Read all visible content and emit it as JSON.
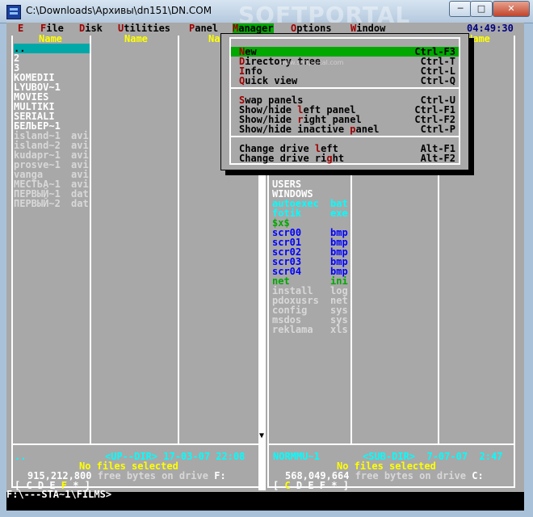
{
  "window": {
    "title": "C:\\Downloads\\Архивы\\dn151\\DN.COM",
    "minimize": "─",
    "maximize": "□",
    "close": "✕",
    "watermark": "SOFTPORTAL",
    "watermark_url": "www.softportal.com"
  },
  "menu": {
    "items": [
      {
        "hk": "E",
        "rest": ""
      },
      {
        "hk": "F",
        "rest": "ile"
      },
      {
        "hk": "D",
        "rest": "isk"
      },
      {
        "hk": "U",
        "rest": "tilities"
      },
      {
        "hk": "P",
        "rest": "anel"
      },
      {
        "hk": "M",
        "rest": "anager"
      },
      {
        "hk": "O",
        "rest": "ptions"
      },
      {
        "hk": "W",
        "rest": "indow"
      }
    ],
    "clock": "04:49:30"
  },
  "left_panel": {
    "col_headers": [
      "Name",
      "Name",
      "Na"
    ],
    "files": [
      {
        "name": "..",
        "ext": "",
        "type": "sel"
      },
      {
        "name": "2",
        "ext": "",
        "type": "dir"
      },
      {
        "name": "3",
        "ext": "",
        "type": "dir"
      },
      {
        "name": "KOMEDII",
        "ext": "",
        "type": "dir"
      },
      {
        "name": "LYUBOV~1",
        "ext": "",
        "type": "dir"
      },
      {
        "name": "MOVIES",
        "ext": "",
        "type": "dir"
      },
      {
        "name": "MULTIKI",
        "ext": "",
        "type": "dir"
      },
      {
        "name": "SERIALI",
        "ext": "",
        "type": "dir"
      },
      {
        "name": "БЕЛЬЕР~1",
        "ext": "",
        "type": "dir"
      },
      {
        "name": "island~1",
        "ext": "avi",
        "type": "file"
      },
      {
        "name": "island~2",
        "ext": "avi",
        "type": "file"
      },
      {
        "name": "kudapr~1",
        "ext": "avi",
        "type": "file"
      },
      {
        "name": "prosve~1",
        "ext": "avi",
        "type": "file"
      },
      {
        "name": "vanga",
        "ext": "avi",
        "type": "file"
      },
      {
        "name": "МЕСТЬА~1",
        "ext": "avi",
        "type": "file"
      },
      {
        "name": "ПЕРВЫЙ~1",
        "ext": "dat",
        "type": "file"
      },
      {
        "name": "ПЕРВЫЙ~2",
        "ext": "dat",
        "type": "file"
      }
    ],
    "status_name": "..",
    "status_info": "<UP--DIR> 17-03-07 22:08",
    "no_files": "No files selected",
    "free_num": "915,212,800",
    "free_text": " free bytes on drive",
    "drive": "F:",
    "drives_prefix": "[ C D E ",
    "drives_active": "F",
    "drives_suffix": " * ]"
  },
  "right_panel": {
    "col_header": "Name",
    "files": [
      {
        "name": "USERS",
        "ext": "",
        "type": "dir"
      },
      {
        "name": "WINDOWS",
        "ext": "",
        "type": "dir"
      },
      {
        "name": "autoexec",
        "ext": "bat",
        "type": "exe"
      },
      {
        "name": "fotik",
        "ext": "exe",
        "type": "exe"
      },
      {
        "name": "$x$",
        "ext": "",
        "type": "grn"
      },
      {
        "name": "scr00",
        "ext": "bmp",
        "type": "img"
      },
      {
        "name": "scr01",
        "ext": "bmp",
        "type": "img"
      },
      {
        "name": "scr02",
        "ext": "bmp",
        "type": "img"
      },
      {
        "name": "scr03",
        "ext": "bmp",
        "type": "img"
      },
      {
        "name": "scr04",
        "ext": "bmp",
        "type": "img"
      },
      {
        "name": "net",
        "ext": "ini",
        "type": "grn"
      },
      {
        "name": "install",
        "ext": "log",
        "type": "file"
      },
      {
        "name": "pdoxusrs",
        "ext": "net",
        "type": "file"
      },
      {
        "name": "config",
        "ext": "sys",
        "type": "file"
      },
      {
        "name": "msdos",
        "ext": "sys",
        "type": "file"
      },
      {
        "name": "reklama",
        "ext": "xls",
        "type": "file"
      }
    ],
    "status_name": "NORMMU~1",
    "status_info": "<SUB-DIR>  7-07-07  2:47",
    "no_files": "No files selected",
    "free_num": "568,049,664",
    "free_text": " free bytes on drive",
    "drive": "C:",
    "drives_prefix": "[ ",
    "drives_active": "C",
    "drives_suffix": " D E F * ]"
  },
  "manager_menu": {
    "items": [
      {
        "hk": "N",
        "rest": "ew",
        "key": "Ctrl-F3",
        "highlighted": true
      },
      {
        "hk": "D",
        "rest": "irectory tree",
        "key": "Ctrl-T",
        "highlighted": false
      },
      {
        "hk": "I",
        "rest": "nfo",
        "key": "Ctrl-L",
        "highlighted": false
      },
      {
        "hk": "Q",
        "rest": "uick view",
        "key": "Ctrl-Q",
        "highlighted": false
      },
      {
        "hk": "S",
        "rest": "wap panels",
        "key": "Ctrl-U",
        "highlighted": false
      },
      {
        "pre": "Show/hide ",
        "hk": "l",
        "rest": "eft panel",
        "key": "Ctrl-F1",
        "highlighted": false
      },
      {
        "pre": "Show/hide ",
        "hk": "r",
        "rest": "ight panel",
        "key": "Ctrl-F2",
        "highlighted": false
      },
      {
        "pre": "Show/hide inactive ",
        "hk": "p",
        "rest": "anel",
        "key": "Ctrl-P",
        "highlighted": false
      },
      {
        "pre": "Change drive ",
        "hk": "l",
        "rest": "eft",
        "key": "Alt-F1",
        "highlighted": false
      },
      {
        "pre": "Change drive ri",
        "hk": "g",
        "rest": "ht",
        "key": "Alt-F2",
        "highlighted": false
      }
    ]
  },
  "command_line": "F:\\---STA~1\\FILMS>",
  "colors": {
    "panel_bg": "#a8a8a8",
    "selection": "#00a8a8",
    "menu_highlight": "#00a800",
    "hotkey": "#a00000"
  }
}
